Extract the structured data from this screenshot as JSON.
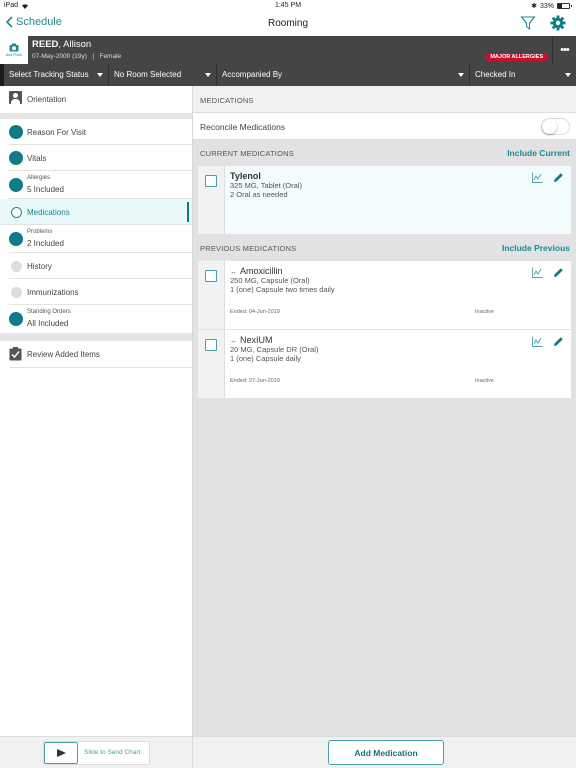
{
  "status_bar": {
    "device": "iPad",
    "time": "1:45 PM",
    "battery": "33%",
    "battery_level": 0.33
  },
  "nav": {
    "back_label": "Schedule",
    "title": "Rooming",
    "icons": [
      "filter-icon",
      "gear-icon"
    ]
  },
  "patient": {
    "add_photo_label": "Add Photo",
    "last_name": "REED",
    "first_name": ", Allison",
    "dob": "07-May-2000 (19y)",
    "separator": "|",
    "sex": "Female",
    "allergy_badge": "MAJOR ALLERGIES",
    "more_label": "•••"
  },
  "dropdowns": {
    "tracking_status": "Select Tracking Status",
    "room": "No Room Selected",
    "accompanied_by": "Accompanied By",
    "check_status": "Checked In"
  },
  "sidebar": {
    "orientation": "Orientation",
    "items": [
      {
        "label": "Reason For Visit",
        "state": "filled"
      },
      {
        "label": "Vitals",
        "state": "filled"
      },
      {
        "sub": "Allergies",
        "label": "5 Included",
        "state": "filled"
      },
      {
        "label": "Medications",
        "state": "active"
      },
      {
        "sub": "Problems",
        "label": "2 Included",
        "state": "filled"
      },
      {
        "label": "History",
        "state": "gray"
      },
      {
        "label": "Immunizations",
        "state": "gray"
      },
      {
        "sub": "Standing Orders",
        "label": "All Included",
        "state": "filled"
      }
    ],
    "review": "Review Added Items"
  },
  "main": {
    "section_title": "MEDICATIONS",
    "reconcile_label": "Reconcile Medications",
    "reconcile_on": false,
    "current_header": "CURRENT MEDICATIONS",
    "include_current": "Include Current",
    "current_meds": [
      {
        "name": "Tylenol",
        "dose": "325 MG, Tablet (Oral)",
        "sig": "2 Oral as needed"
      }
    ],
    "previous_header": "PREVIOUS MEDICATIONS",
    "include_previous": "Include Previous",
    "previous_meds": [
      {
        "ext_icon": "↔",
        "name": "Amoxicillin",
        "dose": "250 MG, Capsule (Oral)",
        "sig": "1 (one) Capsule two times daily",
        "ended": "Ended: 04-Jun-2019",
        "status": "Inactive"
      },
      {
        "ext_icon": "↔",
        "name": "NexIUM",
        "dose": "20 MG, Capsule DR (Oral)",
        "sig": "1 (one) Capsule daily",
        "ended": "Ended: 27-Jun-2019",
        "status": "Inactive"
      }
    ]
  },
  "footer": {
    "slide_label": "Slide to Send Chart",
    "add_medication": "Add Medication"
  },
  "colors": {
    "accent": "#1b8a94",
    "dot": "#0e7b85",
    "header_bg": "#454545",
    "allergy_red": "#c8102e"
  }
}
